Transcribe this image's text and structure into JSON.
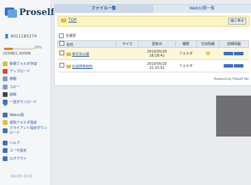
{
  "brand": {
    "name": "Proself"
  },
  "user": {
    "id": "9011185274"
  },
  "quota": {
    "text": "293MB/1,000MB",
    "percent_label": "29%",
    "fraction": 0.29,
    "color": "#e07b2c"
  },
  "tabs": [
    {
      "label": "ファイル一覧",
      "active": true
    },
    {
      "label": "Web公開一覧",
      "active": false
    }
  ],
  "breadcrumb": {
    "label": "TOP"
  },
  "toolbar": {
    "size_label": "縮小表示"
  },
  "select_all_label": "全選択",
  "table": {
    "headers": [
      "名前",
      "サイズ",
      "更新日",
      "種類",
      "付加情報",
      "詳細情報"
    ],
    "rows": [
      {
        "name": "取引先公開",
        "size": "",
        "updated": "2010/05/26 18:18:41",
        "kind": "フォルダ"
      },
      {
        "name": "社員研修資料",
        "size": "",
        "updated": "2010/05/20 21:33:52",
        "kind": "フォルダ"
      }
    ]
  },
  "powered": {
    "prefix": "Powered by ",
    "brand": "Proself Ver."
  },
  "menu": [
    {
      "label": "新規フォルダ作成",
      "icon": "new-folder-icon",
      "color": "#e8b93a"
    },
    {
      "label": "アップロード",
      "icon": "upload-icon",
      "color": "#d9463b"
    },
    {
      "label": "移動",
      "icon": "move-icon",
      "color": "#7a9cc9"
    },
    {
      "label": "コピー",
      "icon": "copy-icon",
      "color": "#7a9cc9"
    },
    {
      "label": "削除",
      "icon": "delete-icon",
      "color": "#444"
    },
    {
      "label": "一括ダウンロード",
      "icon": "download-icon",
      "color": "#3d6fc8"
    },
    {
      "label": "Web公開",
      "icon": "web-publish-icon",
      "color": "#3d6fc8"
    },
    {
      "label": "受取フォルダ指定",
      "icon": "receive-folder-icon",
      "color": "#e8b93a"
    },
    {
      "label": "クライアント指定ダウンロード",
      "icon": "client-download-icon",
      "color": "#3d6fc8"
    },
    {
      "label": "ヘルプ",
      "icon": "help-icon",
      "color": "#3d6fc8"
    },
    {
      "label": "ユーザ設定",
      "icon": "user-settings-icon",
      "color": "#3d6fc8"
    },
    {
      "label": "ログアウト",
      "icon": "logout-icon",
      "color": "#3d6fc8"
    }
  ],
  "footer": {
    "label": "North Grid"
  }
}
